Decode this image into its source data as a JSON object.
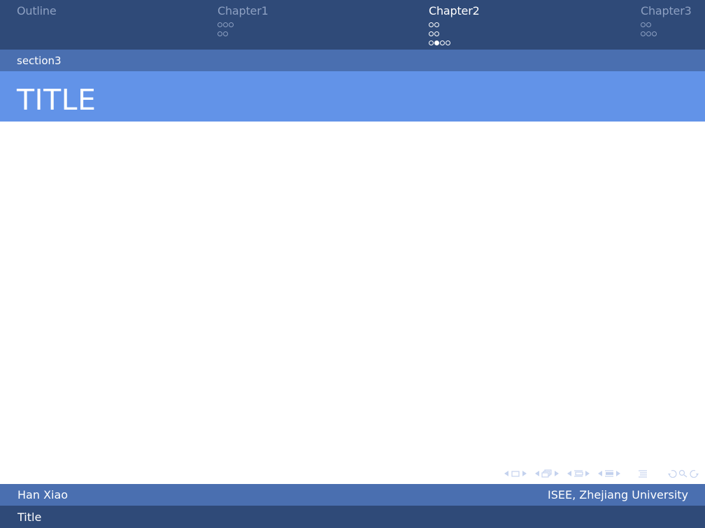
{
  "headline": {
    "sections": [
      {
        "title": "Outline",
        "active": false,
        "dots": []
      },
      {
        "title": "Chapter1",
        "active": false,
        "dots": [
          [
            0,
            0,
            0
          ],
          [
            0,
            0
          ]
        ]
      },
      {
        "title": "Chapter2",
        "active": true,
        "dots": [
          [
            0,
            0
          ],
          [
            0,
            0
          ],
          [
            0,
            1,
            0,
            0
          ]
        ]
      },
      {
        "title": "Chapter3",
        "active": false,
        "dots": [
          [
            0,
            0
          ],
          [
            0,
            0,
            0
          ]
        ]
      }
    ]
  },
  "subsection": "section3",
  "frame_title": "TITLE",
  "nav_symbols": [
    "slide-nav-icon",
    "frame-nav-icon",
    "subsection-nav-icon",
    "section-nav-icon",
    "document-nav-icon",
    "search-icon"
  ],
  "footer": {
    "author": "Han Xiao",
    "institute": "ISEE, Zhejiang University",
    "short_title": "Title"
  },
  "colors": {
    "headline_bg": "#2f4a78",
    "subsection_bg": "#4a6fb0",
    "frametitle_bg": "#6293e8"
  }
}
